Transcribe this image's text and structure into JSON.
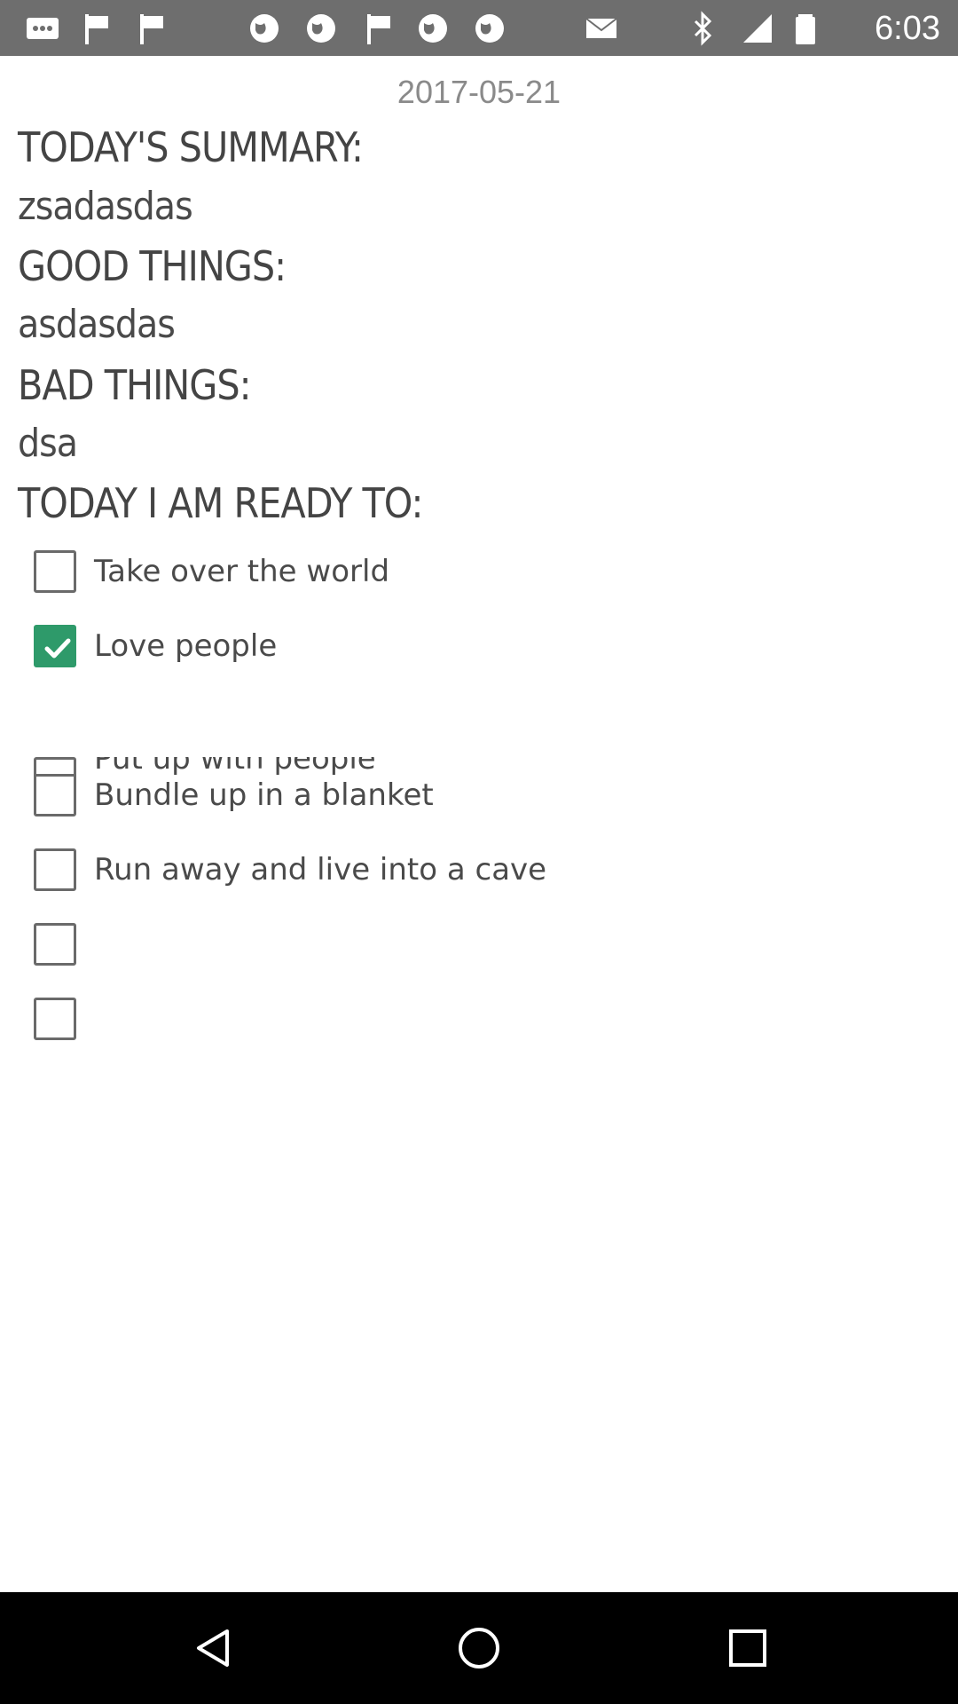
{
  "status_bar": {
    "time": "6:03",
    "left_icons": [
      "more-icon",
      "flag-icon",
      "flag-icon",
      "globe-icon",
      "globe-icon",
      "flag-icon",
      "globe-icon",
      "globe-icon",
      "mail-icon"
    ],
    "right_icons": [
      "bluetooth-icon",
      "signal-icon",
      "battery-icon"
    ]
  },
  "journal": {
    "date": "2017-05-21",
    "summary_heading": "TODAY'S SUMMARY:",
    "summary_value": "zsadasdas",
    "good_heading": "GOOD THINGS:",
    "good_value": "asdasdas",
    "bad_heading": "BAD THINGS:",
    "bad_value": "dsa",
    "ready_heading": "TODAY I AM READY TO:"
  },
  "checklist": [
    {
      "label": "Take over the world",
      "checked": false
    },
    {
      "label": "Love people",
      "checked": true
    },
    {
      "label": "Put up with people",
      "checked": false
    },
    {
      "label": "Bundle up in a blanket",
      "checked": false
    },
    {
      "label": "Run away and live into a cave",
      "checked": false
    },
    {
      "label": "",
      "checked": false
    },
    {
      "label": "",
      "checked": false
    }
  ],
  "colors": {
    "status_bar": "#6e6e6e",
    "check_accent": "#2e9a6a",
    "nav_bar": "#000000"
  },
  "nav": [
    "back-icon",
    "home-icon",
    "recents-icon"
  ]
}
